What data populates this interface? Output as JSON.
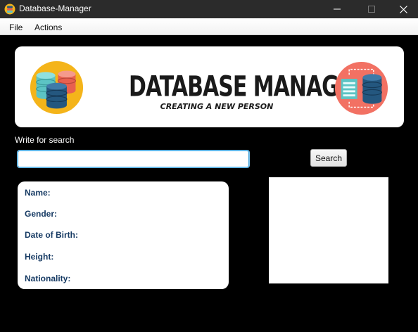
{
  "window": {
    "title": "Database-Manager",
    "minimize_icon": "minimize-icon",
    "maximize_icon": "maximize-icon",
    "close_icon": "close-icon"
  },
  "menu": {
    "items": [
      {
        "label": "File"
      },
      {
        "label": "Actions"
      }
    ]
  },
  "banner": {
    "title": "DATABASE MANAGER",
    "subtitle": "CREATING A NEW PERSON",
    "left_icon": "database-stack-icon",
    "right_icon": "database-transfer-icon",
    "colors": {
      "left_circle": "#f4b41a",
      "right_circle": "#f27163",
      "dark_blue": "#24577f",
      "teal": "#5cc4c4"
    }
  },
  "search": {
    "label": "Write for search",
    "value": "",
    "placeholder": "",
    "button_label": "Search"
  },
  "person": {
    "fields": [
      {
        "label": "Name:"
      },
      {
        "label": "Gender:"
      },
      {
        "label": "Date of Birth:"
      },
      {
        "label": "Height:"
      },
      {
        "label": "Nationality:"
      }
    ]
  },
  "colors": {
    "background": "#000000",
    "titlebar": "#2b2b2b",
    "label_text": "#163a63",
    "input_focus": "#3c9fd8"
  }
}
